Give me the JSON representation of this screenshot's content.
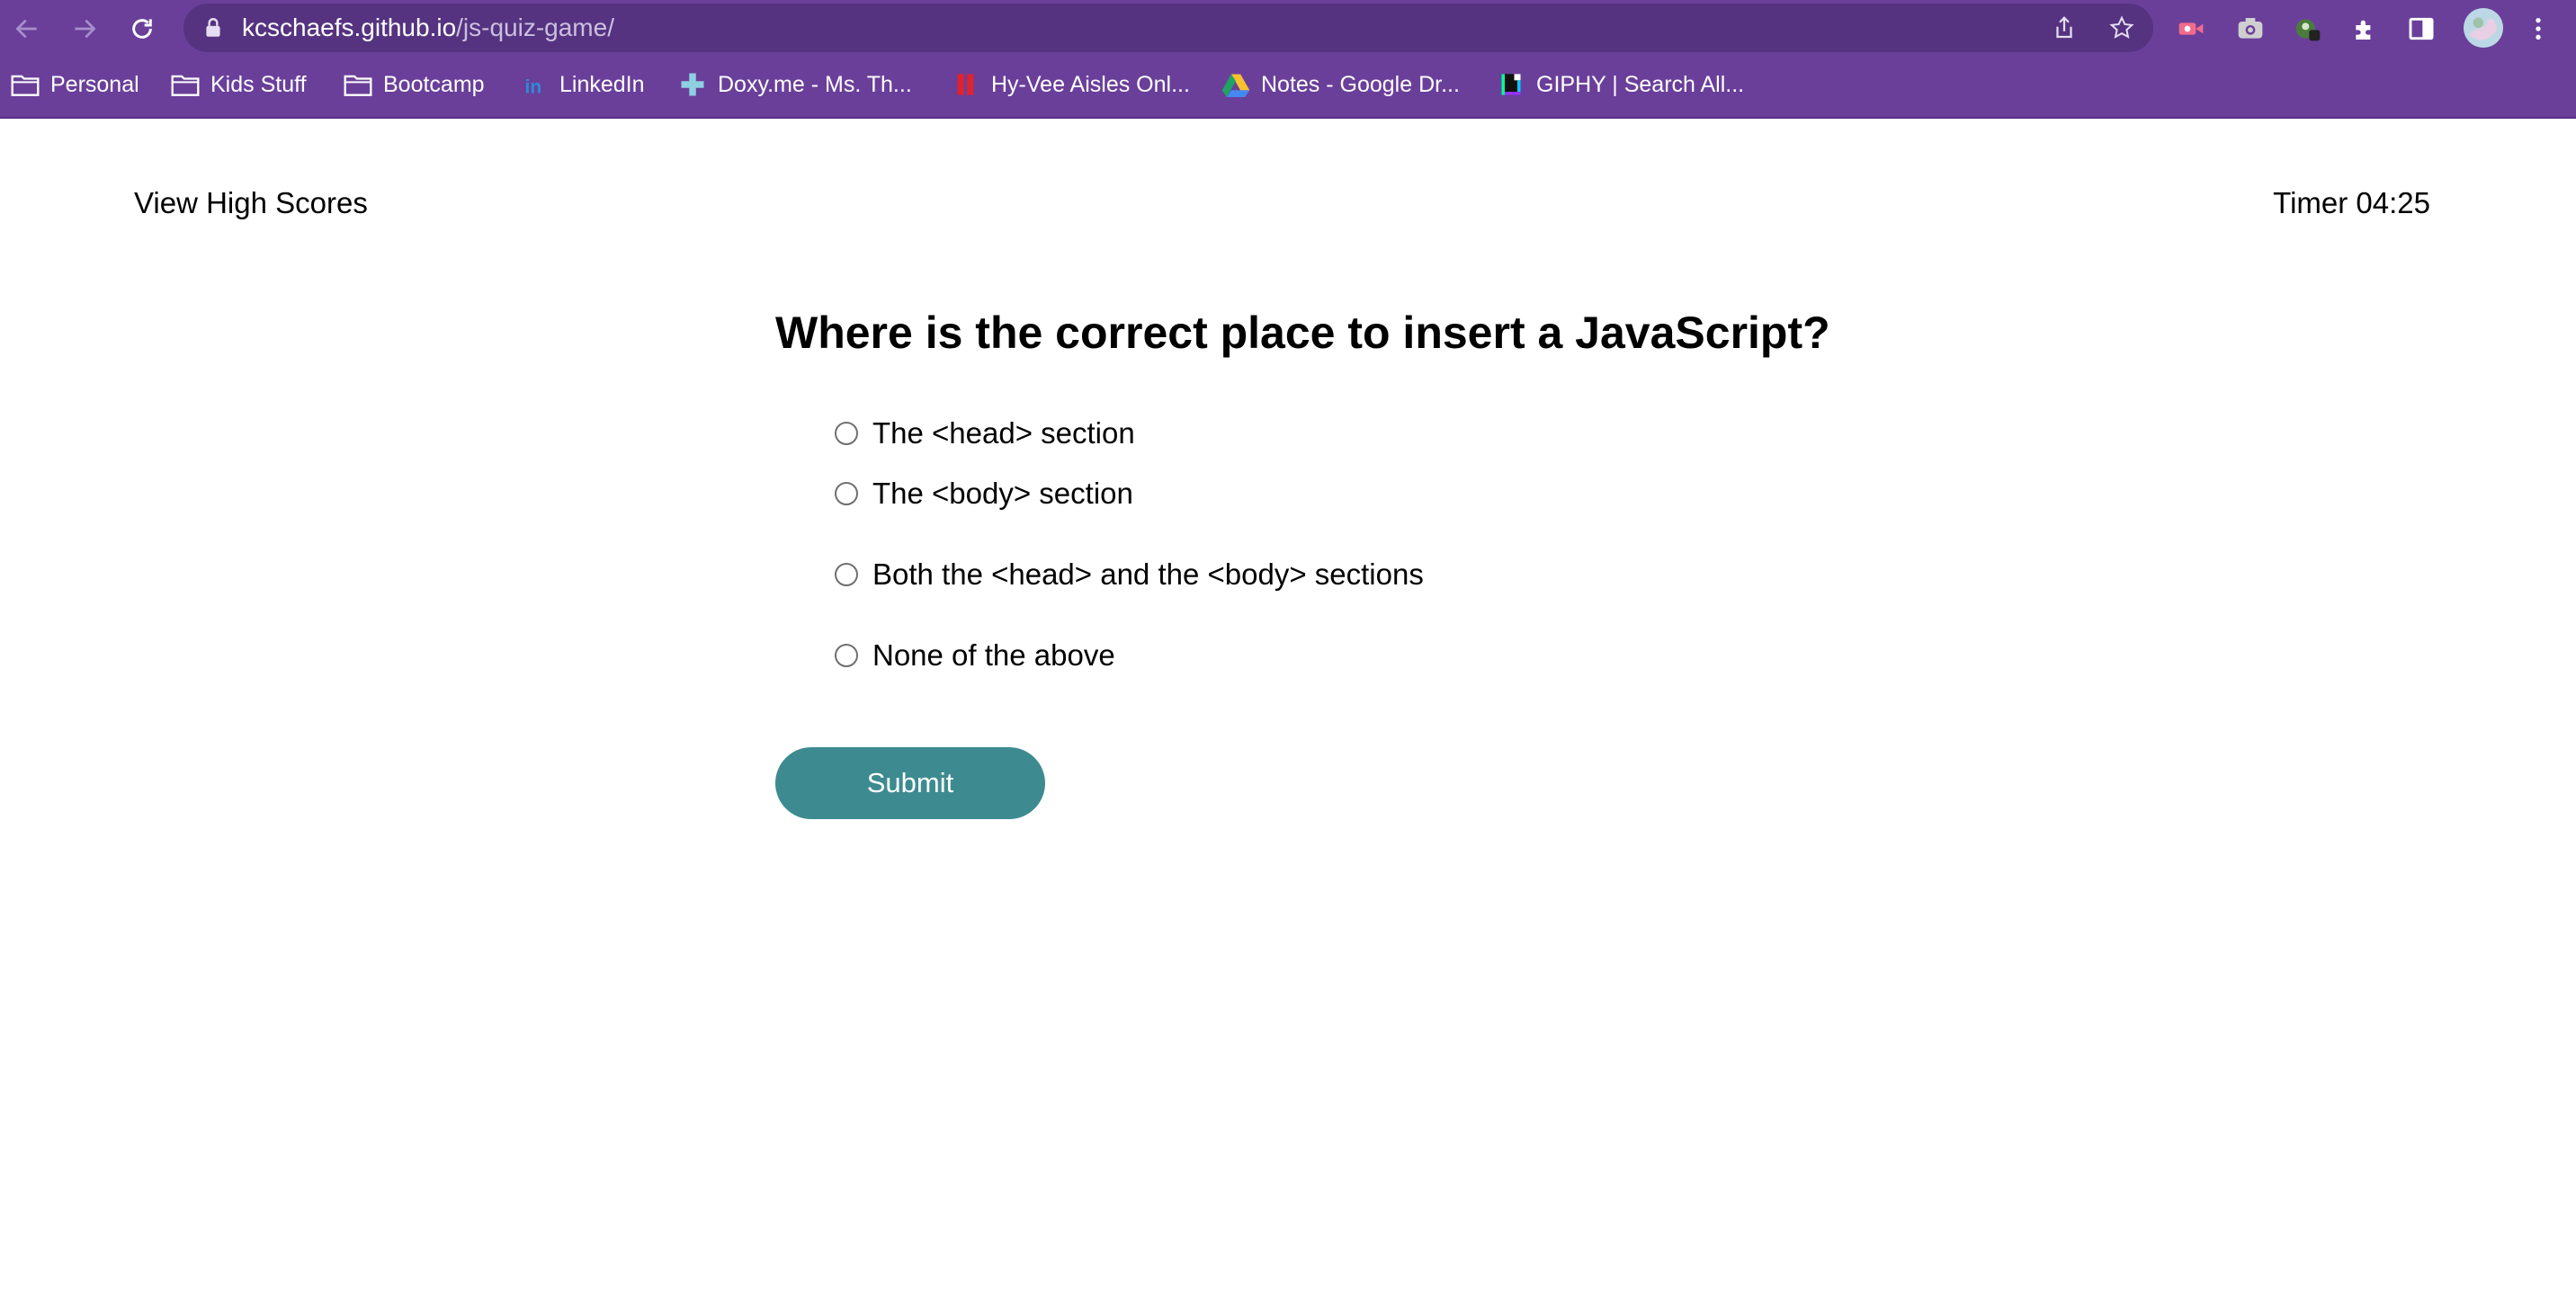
{
  "browser": {
    "url_host": "kcschaefs.github.io",
    "url_path": "/js-quiz-game/",
    "bookmarks": [
      {
        "label": "Personal",
        "icon": "folder-icon"
      },
      {
        "label": "Kids Stuff",
        "icon": "folder-icon"
      },
      {
        "label": "Bootcamp",
        "icon": "folder-icon"
      },
      {
        "label": "LinkedIn",
        "icon": "linkedin-icon"
      },
      {
        "label": "Doxy.me - Ms. Th...",
        "icon": "doxy-icon"
      },
      {
        "label": "Hy-Vee Aisles Onl...",
        "icon": "hyvee-icon"
      },
      {
        "label": "Notes - Google Dr...",
        "icon": "google-drive-icon"
      },
      {
        "label": "GIPHY | Search All...",
        "icon": "giphy-icon"
      }
    ],
    "colors": {
      "chrome": "#6a3f9a",
      "omnibox": "#553380"
    }
  },
  "header": {
    "high_scores_link": "View High Scores",
    "timer": "Timer 04:25"
  },
  "quiz": {
    "question": "Where is the correct place to insert a JavaScript?",
    "choices": [
      "The <head> section",
      "The <body> section",
      "Both the <head> and the <body> sections",
      "None of the above"
    ],
    "submit_label": "Submit",
    "submit_color": "#3d8b90"
  }
}
